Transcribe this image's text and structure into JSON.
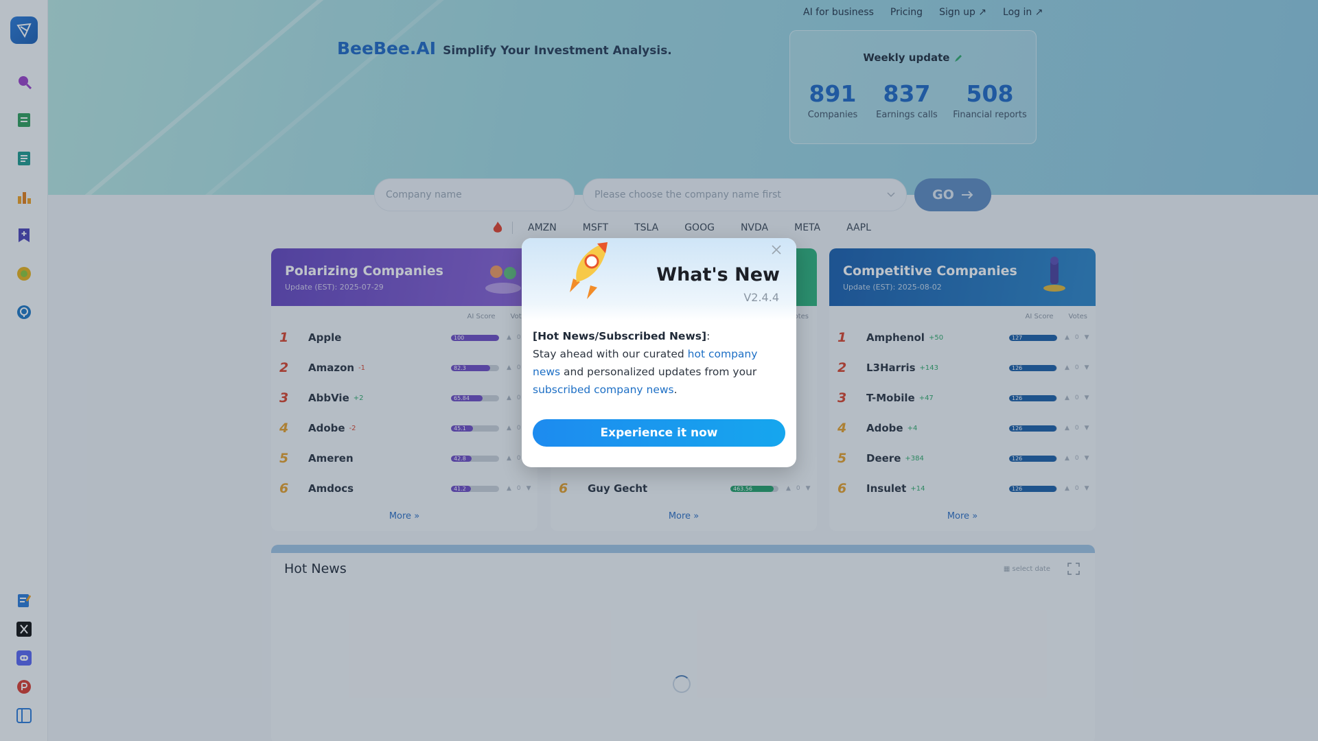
{
  "nav": {
    "links": [
      "AI for business",
      "Pricing",
      "Sign up ↗",
      "Log in ↗"
    ]
  },
  "brand": {
    "name": "BeeBee.AI",
    "tagline": "Simplify Your Investment Analysis."
  },
  "weekly": {
    "title": "Weekly update",
    "stats": [
      {
        "value": "891",
        "label": "Companies"
      },
      {
        "value": "837",
        "label": "Earnings calls"
      },
      {
        "value": "508",
        "label": "Financial reports"
      }
    ]
  },
  "search": {
    "company_placeholder": "Company name",
    "select_placeholder": "Please choose the company name first",
    "go_label": "GO"
  },
  "tickers": [
    "AMZN",
    "MSFT",
    "TSLA",
    "GOOG",
    "NVDA",
    "META",
    "AAPL"
  ],
  "cards": {
    "polarizing": {
      "title": "Polarizing Companies",
      "update": "Update (EST): 2025-07-29",
      "col_score": "AI Score",
      "col_votes": "Votes",
      "more": "More",
      "rows": [
        {
          "rank": "1",
          "name": "Apple",
          "delta": "",
          "score": "100",
          "fill": 1.0
        },
        {
          "rank": "2",
          "name": "Amazon",
          "delta": "-1",
          "score": "82.3",
          "fill": 0.82
        },
        {
          "rank": "3",
          "name": "AbbVie",
          "delta": "+2",
          "score": "65.84",
          "fill": 0.66
        },
        {
          "rank": "4",
          "name": "Adobe",
          "delta": "-2",
          "score": "45.1",
          "fill": 0.45
        },
        {
          "rank": "5",
          "name": "Ameren",
          "delta": "",
          "score": "42.8",
          "fill": 0.43
        },
        {
          "rank": "6",
          "name": "Amdocs",
          "delta": "",
          "score": "41.2",
          "fill": 0.41
        }
      ]
    },
    "middle": {
      "col_votes": "Votes",
      "more": "More",
      "rows": [
        {
          "rank": "6",
          "name": "Guy Gecht",
          "delta": "",
          "score": "463.56",
          "fill": 0.9
        }
      ]
    },
    "competitive": {
      "title": "Competitive Companies",
      "update": "Update (EST): 2025-08-02",
      "col_score": "AI Score",
      "col_votes": "Votes",
      "more": "More",
      "rows": [
        {
          "rank": "1",
          "name": "Amphenol",
          "delta": "+50",
          "score": "127",
          "fill": 1.0
        },
        {
          "rank": "2",
          "name": "L3Harris",
          "delta": "+143",
          "score": "126",
          "fill": 0.99
        },
        {
          "rank": "3",
          "name": "T-Mobile",
          "delta": "+47",
          "score": "126",
          "fill": 0.99
        },
        {
          "rank": "4",
          "name": "Adobe",
          "delta": "+4",
          "score": "126",
          "fill": 0.99
        },
        {
          "rank": "5",
          "name": "Deere",
          "delta": "+384",
          "score": "126",
          "fill": 0.99
        },
        {
          "rank": "6",
          "name": "Insulet",
          "delta": "+14",
          "score": "126",
          "fill": 0.99
        }
      ]
    }
  },
  "hotnews": {
    "title": "Hot News",
    "date_label": "select date"
  },
  "modal": {
    "title": "What's New",
    "version": "V2.4.4",
    "heading": "[Hot News/Subscribed News]",
    "colon": ":",
    "text1": "Stay ahead with our curated ",
    "link1": "hot company news",
    "text2": " and personalized updates from your ",
    "link2": "subscribed company news",
    "text3": ".",
    "button": "Experience it now"
  },
  "colors": {
    "accent": "#1d67c5",
    "polarizing": "#6d4bc4",
    "competitive": "#1b5fa8",
    "middle": "#23a36b",
    "modal_button": "#1d8bef"
  }
}
